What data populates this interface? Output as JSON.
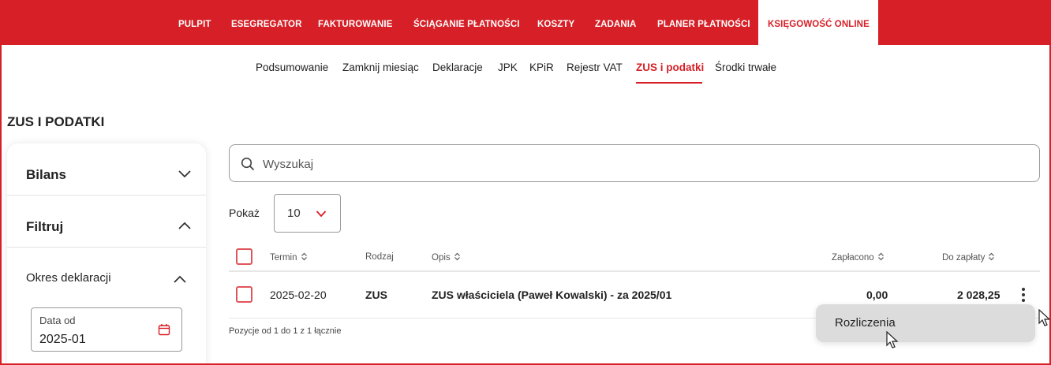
{
  "topnav": {
    "items": [
      "PULPIT",
      "ESEGREGATOR",
      "FAKTUROWANIE",
      "ŚCIĄGANIE PŁATNOŚCI",
      "KOSZTY",
      "ZADANIA",
      "PLANER PŁATNOŚCI",
      "KSIĘGOWOŚĆ ONLINE"
    ],
    "active": "KSIĘGOWOŚĆ ONLINE"
  },
  "subnav": {
    "items": [
      "Podsumowanie",
      "Zamknij miesiąc",
      "Deklaracje",
      "JPK",
      "KPiR",
      "Rejestr VAT",
      "ZUS i podatki",
      "Środki trwałe"
    ],
    "active": "ZUS i podatki"
  },
  "page_title": "ZUS I PODATKI",
  "sidebar": {
    "sections": [
      {
        "label": "Bilans",
        "expanded": false
      },
      {
        "label": "Filtruj",
        "expanded": true
      }
    ],
    "subsection": "Okres deklaracji",
    "date_from": {
      "label": "Data od",
      "value": "2025-01"
    }
  },
  "search": {
    "placeholder": "Wyszukaj"
  },
  "pagesize": {
    "label": "Pokaż",
    "value": "10"
  },
  "table": {
    "headers": {
      "termin": "Termin",
      "rodzaj": "Rodzaj",
      "opis": "Opis",
      "zaplacono": "Zapłacono",
      "do_zaplaty": "Do zapłaty"
    },
    "rows": [
      {
        "termin": "2025-02-20",
        "rodzaj": "ZUS",
        "opis": "ZUS właściciela (Paweł Kowalski) - za 2025/01",
        "zaplacono": "0,00",
        "do_zaplaty": "2 028,25"
      }
    ],
    "footer": "Pozycje od 1 do 1 z 1 łącznie"
  },
  "menu": {
    "items": [
      "Rozliczenia"
    ]
  },
  "colors": {
    "brand": "#d61f26",
    "menu_bg": "#dcdcdc"
  }
}
